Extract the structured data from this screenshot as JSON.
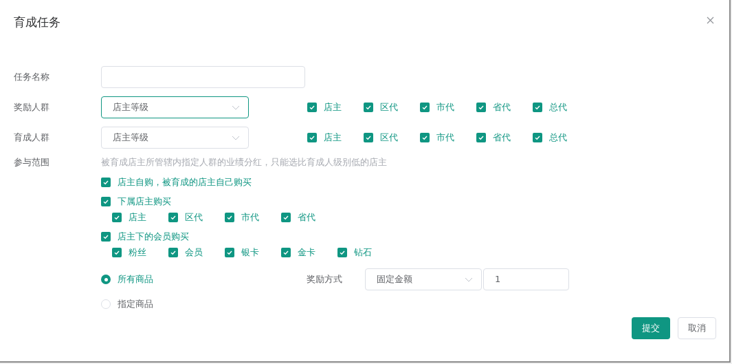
{
  "dialog": {
    "title": "育成任务"
  },
  "task_name": {
    "label": "任务名称"
  },
  "reward_group": {
    "label": "奖励人群",
    "select": "店主等级",
    "focused": true,
    "options": [
      {
        "label": "店主",
        "checked": true
      },
      {
        "label": "区代",
        "checked": true
      },
      {
        "label": "市代",
        "checked": true
      },
      {
        "label": "省代",
        "checked": true
      },
      {
        "label": "总代",
        "checked": true
      }
    ]
  },
  "train_group": {
    "label": "育成人群",
    "select": "店主等级",
    "focused": false,
    "options": [
      {
        "label": "店主",
        "checked": true
      },
      {
        "label": "区代",
        "checked": true
      },
      {
        "label": "市代",
        "checked": true
      },
      {
        "label": "省代",
        "checked": true
      },
      {
        "label": "总代",
        "checked": true
      }
    ]
  },
  "scope": {
    "label": "参与范围",
    "hint": "被育成店主所管辖内指定人群的业绩分红，只能选比育成人级别低的店主",
    "items": [
      {
        "label": "店主自购，被育成的店主自己购买",
        "checked": true
      },
      {
        "label": "下属店主购买",
        "checked": true,
        "children": [
          {
            "label": "店主",
            "checked": true
          },
          {
            "label": "区代",
            "checked": true
          },
          {
            "label": "市代",
            "checked": true
          },
          {
            "label": "省代",
            "checked": true
          }
        ]
      },
      {
        "label": "店主下的会员购买",
        "checked": true,
        "children": [
          {
            "label": "粉丝",
            "checked": true
          },
          {
            "label": "会员",
            "checked": true
          },
          {
            "label": "银卡",
            "checked": true
          },
          {
            "label": "金卡",
            "checked": true
          },
          {
            "label": "钻石",
            "checked": true
          }
        ]
      }
    ]
  },
  "goods": [
    {
      "label": "所有商品",
      "selected": true
    },
    {
      "label": "指定商品",
      "selected": false
    }
  ],
  "reward_method": {
    "label": "奖励方式",
    "select": "固定金额",
    "amount": "1"
  },
  "buttons": [
    {
      "label": "提交",
      "kind": "primary"
    },
    {
      "label": "取消",
      "kind": "default"
    }
  ]
}
